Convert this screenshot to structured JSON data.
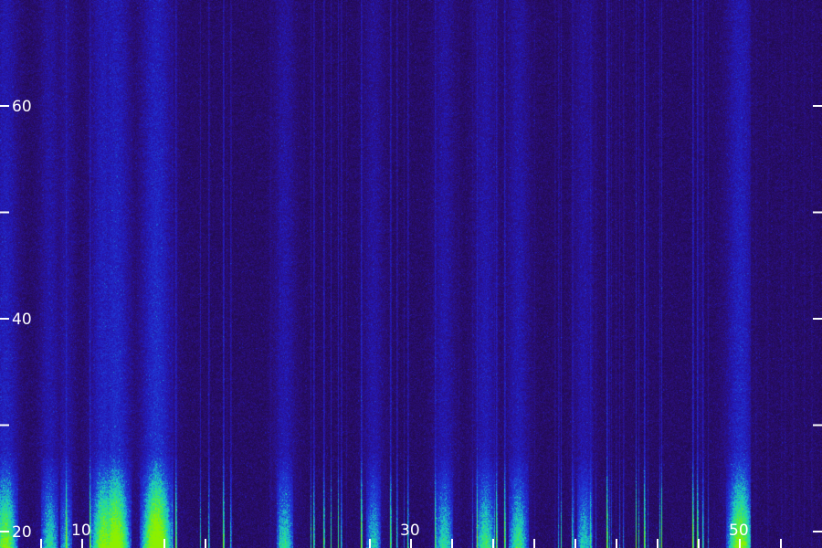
{
  "chart_data": {
    "type": "heatmap",
    "title": "",
    "xlabel": "",
    "ylabel": "",
    "xlim": [
      5,
      55
    ],
    "ylim": [
      20,
      70
    ],
    "x_ticks": [
      10,
      30,
      50
    ],
    "x_tick_labels": [
      "10",
      "30",
      "50"
    ],
    "x_minor_ticks": [
      7.5,
      10,
      15,
      17.5,
      27.5,
      30,
      32.5,
      35,
      37.5,
      40,
      42.5,
      45,
      47.5,
      50,
      52.5
    ],
    "y_ticks": [
      20,
      40,
      60
    ],
    "y_tick_labels": [
      "20",
      "40",
      "60"
    ],
    "y_minor_ticks": [
      30,
      50
    ],
    "grid": false,
    "colormap": [
      "#1a0a38",
      "#2a0d6e",
      "#2418b8",
      "#1f3fd8",
      "#18c8c8",
      "#36e86a",
      "#8cf000"
    ],
    "background_color": "#1a0a38",
    "tick_color": "#ffffff",
    "strong_columns": [
      {
        "x": 5.3,
        "intensity": 0.75
      },
      {
        "x": 8.0,
        "intensity": 0.55
      },
      {
        "x": 9.0,
        "intensity": 0.45
      },
      {
        "x": 11.3,
        "intensity": 0.8
      },
      {
        "x": 12.0,
        "intensity": 0.9
      },
      {
        "x": 14.5,
        "intensity": 0.95
      },
      {
        "x": 22.3,
        "intensity": 0.55
      },
      {
        "x": 27.7,
        "intensity": 0.5
      },
      {
        "x": 32.0,
        "intensity": 0.55
      },
      {
        "x": 34.5,
        "intensity": 0.6
      },
      {
        "x": 36.5,
        "intensity": 0.6
      },
      {
        "x": 40.5,
        "intensity": 0.5
      },
      {
        "x": 50.0,
        "intensity": 0.8
      }
    ]
  }
}
